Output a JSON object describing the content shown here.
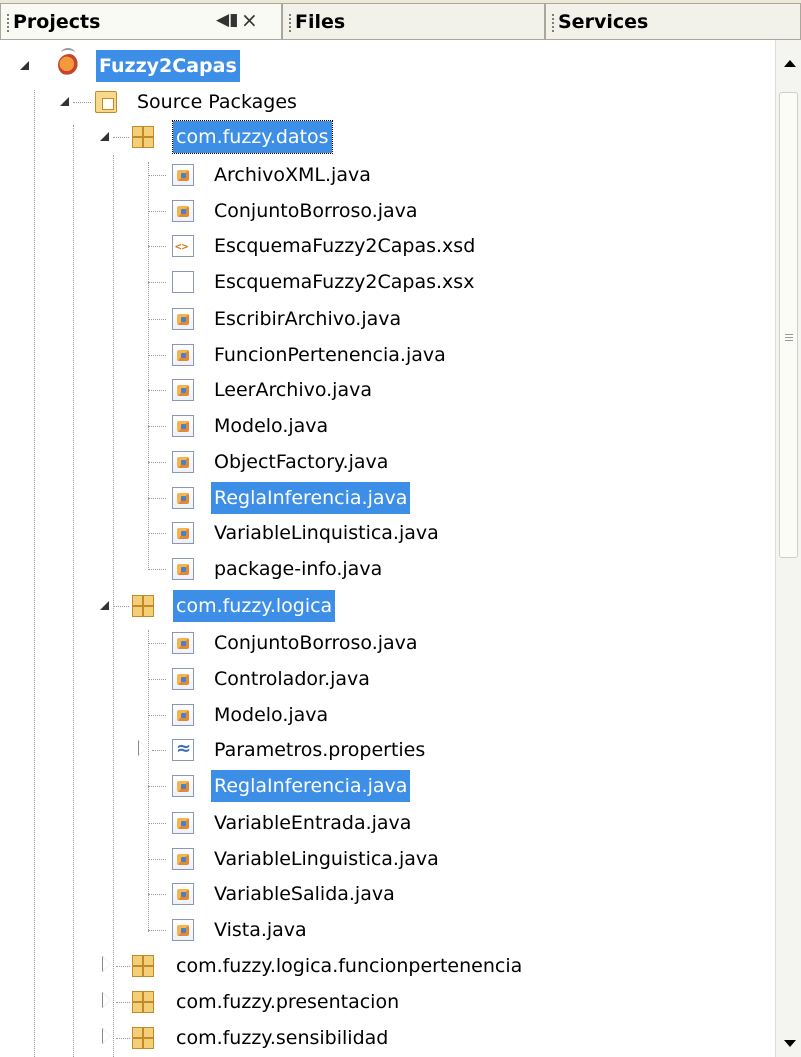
{
  "tabs": [
    {
      "label": "Projects",
      "active": true,
      "minimize_glyph": "◀▮",
      "close_glyph": "×"
    },
    {
      "label": "Files",
      "active": false
    },
    {
      "label": "Services",
      "active": false
    }
  ],
  "tree": {
    "root": {
      "label": "Fuzzy2Capas",
      "icon": "project-icon"
    },
    "source_packages": {
      "label": "Source Packages",
      "icon": "source-packages-icon"
    },
    "pkg_datos": {
      "label": "com.fuzzy.datos",
      "files": [
        {
          "label": "ArchivoXML.java",
          "icon": "java-file-icon"
        },
        {
          "label": "ConjuntoBorroso.java",
          "icon": "java-file-icon"
        },
        {
          "label": "EscquemaFuzzy2Capas.xsd",
          "icon": "xsd-file-icon"
        },
        {
          "label": "EscquemaFuzzy2Capas.xsx",
          "icon": "blank-file-icon"
        },
        {
          "label": "EscribirArchivo.java",
          "icon": "java-file-icon"
        },
        {
          "label": "FuncionPertenencia.java",
          "icon": "java-file-icon"
        },
        {
          "label": "LeerArchivo.java",
          "icon": "java-file-icon"
        },
        {
          "label": "Modelo.java",
          "icon": "java-file-icon"
        },
        {
          "label": "ObjectFactory.java",
          "icon": "java-file-icon"
        },
        {
          "label": "ReglaInferencia.java",
          "icon": "java-file-icon",
          "selected": true
        },
        {
          "label": "VariableLinquistica.java",
          "icon": "java-file-icon"
        },
        {
          "label": "package-info.java",
          "icon": "java-file-icon"
        }
      ]
    },
    "pkg_logica": {
      "label": "com.fuzzy.logica",
      "files": [
        {
          "label": "ConjuntoBorroso.java",
          "icon": "java-file-icon"
        },
        {
          "label": "Controlador.java",
          "icon": "java-file-icon"
        },
        {
          "label": "Modelo.java",
          "icon": "java-file-icon"
        },
        {
          "label": "Parametros.properties",
          "icon": "properties-file-icon"
        },
        {
          "label": "ReglaInferencia.java",
          "icon": "java-file-icon",
          "selected": true
        },
        {
          "label": "VariableEntrada.java",
          "icon": "java-file-icon"
        },
        {
          "label": "VariableLinguistica.java",
          "icon": "java-file-icon"
        },
        {
          "label": "VariableSalida.java",
          "icon": "java-file-icon"
        },
        {
          "label": "Vista.java",
          "icon": "java-file-icon"
        }
      ]
    },
    "collapsed_packages": [
      {
        "label": "com.fuzzy.logica.funcionpertenencia"
      },
      {
        "label": "com.fuzzy.presentacion"
      },
      {
        "label": "com.fuzzy.sensibilidad"
      }
    ]
  },
  "colors": {
    "selection": "#3d8ee6",
    "tab_background": "#ece9d8"
  }
}
